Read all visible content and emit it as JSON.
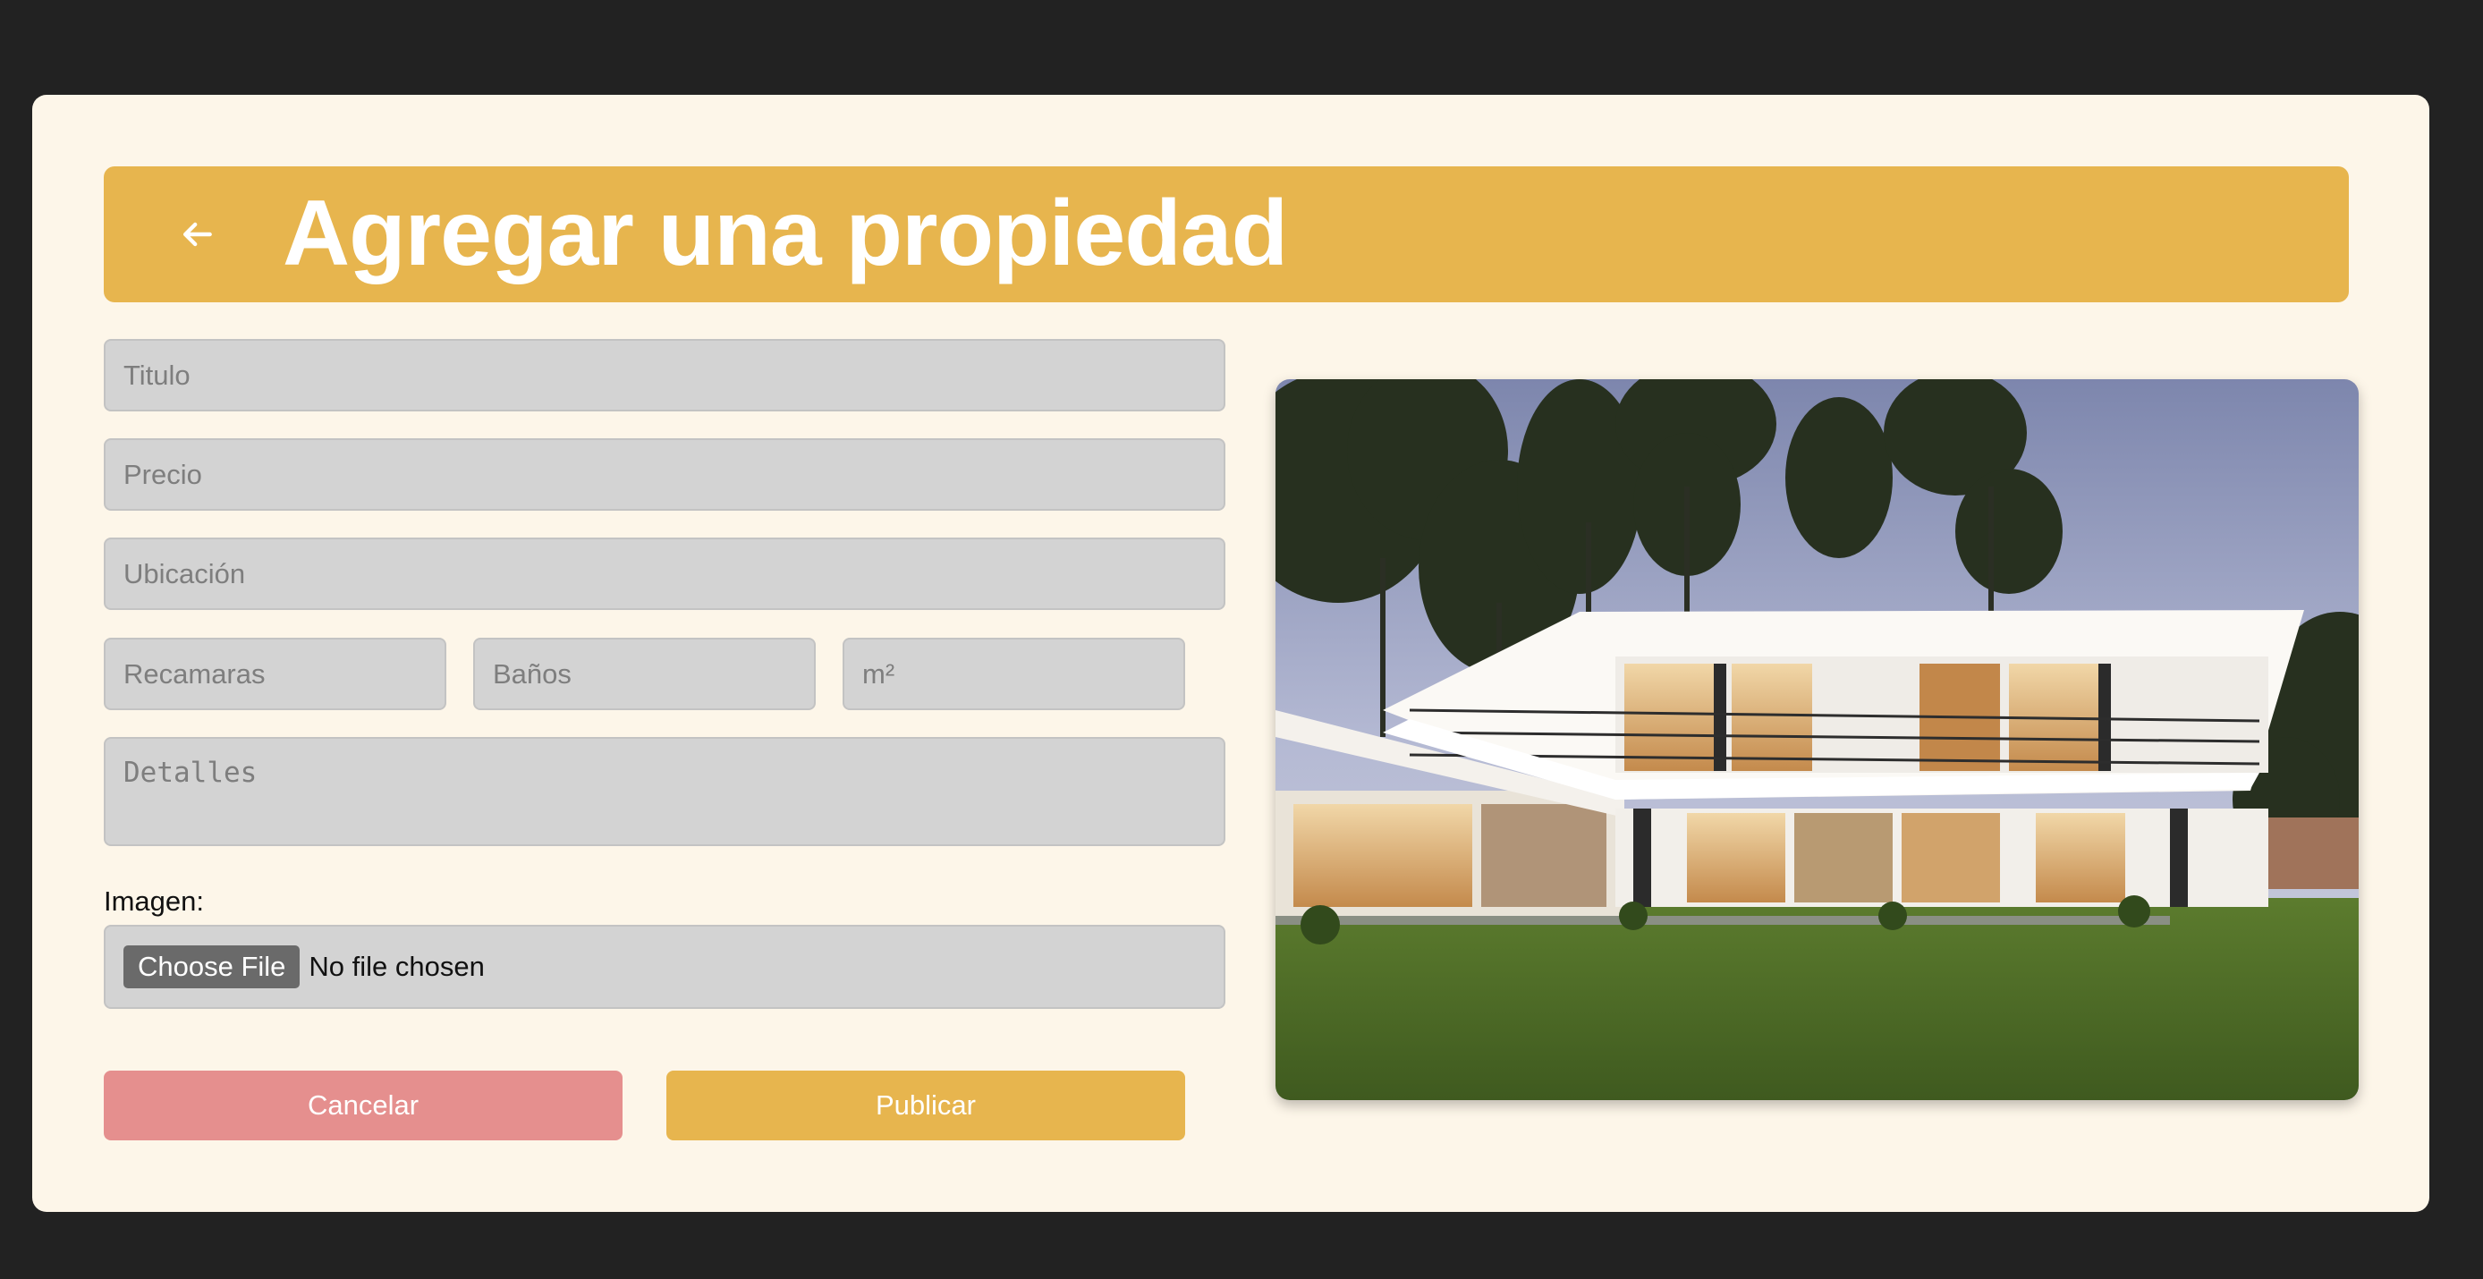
{
  "header": {
    "title": "Agregar una propiedad",
    "back_icon": "arrow-left-icon"
  },
  "form": {
    "titulo_placeholder": "Titulo",
    "precio_placeholder": "Precio",
    "ubicacion_placeholder": "Ubicación",
    "recamaras_placeholder": "Recamaras",
    "banos_placeholder": "Baños",
    "m2_placeholder": "m²",
    "detalles_placeholder": "Detalles",
    "imagen_label": "Imagen:",
    "choose_file_label": "Choose File",
    "no_file_text": "No file chosen"
  },
  "actions": {
    "cancel_label": "Cancelar",
    "publish_label": "Publicar"
  },
  "colors": {
    "page_bg": "#222222",
    "card_bg": "#fdf6e9",
    "accent": "#e7b54e",
    "cancel": "#e58f8e",
    "input_bg": "#d3d3d3"
  }
}
